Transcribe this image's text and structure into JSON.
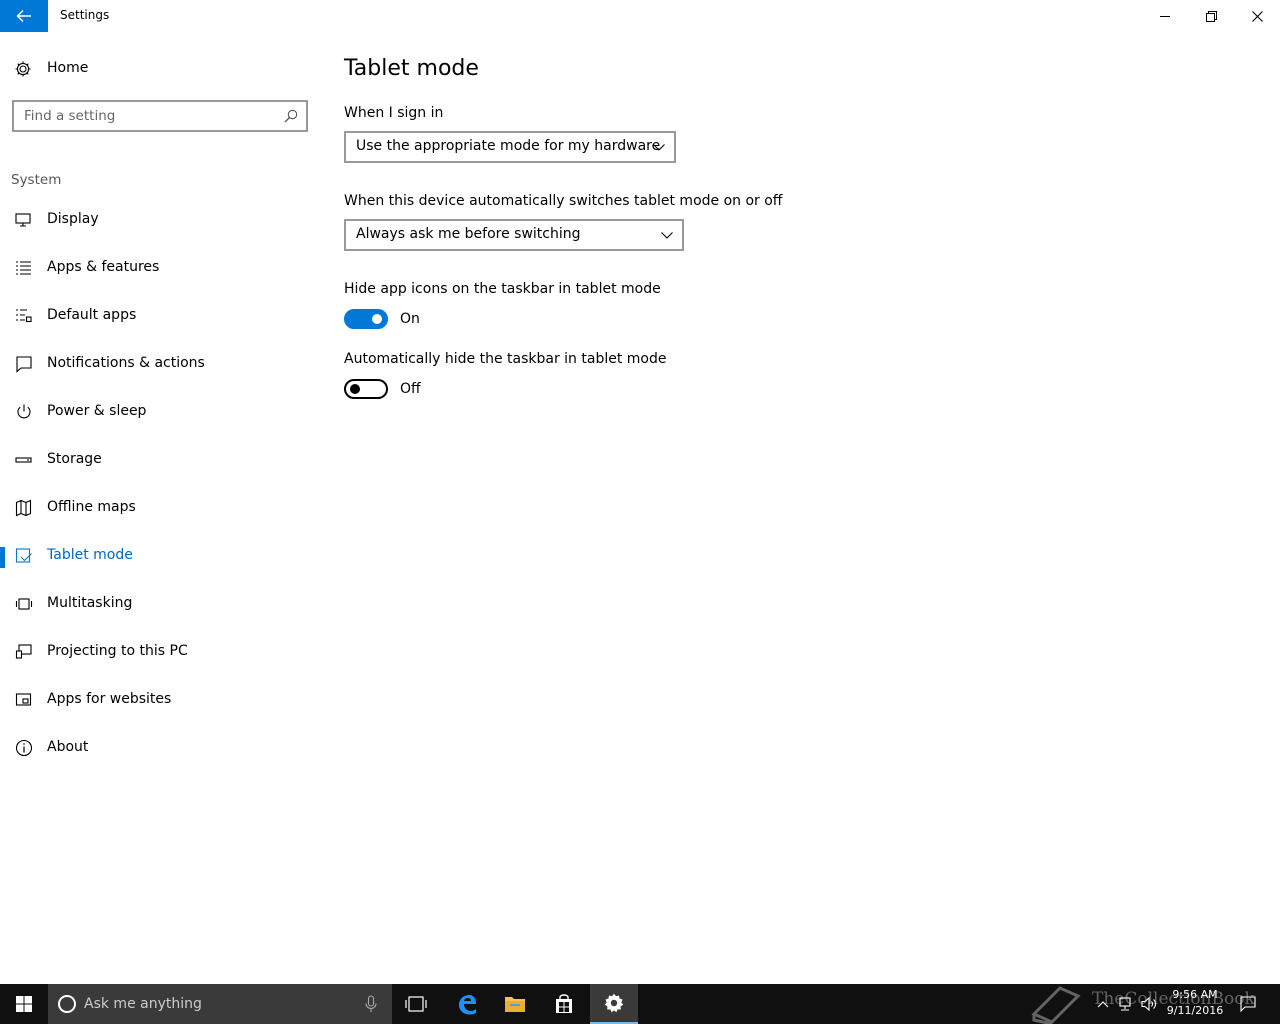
{
  "window": {
    "title": "Settings",
    "back_icon": "arrow-left-icon",
    "controls": [
      "minimize-icon",
      "restore-icon",
      "close-icon"
    ]
  },
  "sidebar": {
    "home_label": "Home",
    "search_placeholder": "Find a setting",
    "section_label": "System",
    "items": [
      {
        "label": "Display",
        "icon": "monitor-icon"
      },
      {
        "label": "Apps & features",
        "icon": "list-icon"
      },
      {
        "label": "Default apps",
        "icon": "default-apps-icon"
      },
      {
        "label": "Notifications & actions",
        "icon": "notification-icon"
      },
      {
        "label": "Power & sleep",
        "icon": "power-icon"
      },
      {
        "label": "Storage",
        "icon": "storage-icon"
      },
      {
        "label": "Offline maps",
        "icon": "map-icon"
      },
      {
        "label": "Tablet mode",
        "icon": "tablet-icon",
        "active": true
      },
      {
        "label": "Multitasking",
        "icon": "multitasking-icon"
      },
      {
        "label": "Projecting to this PC",
        "icon": "projecting-icon"
      },
      {
        "label": "Apps for websites",
        "icon": "apps-websites-icon"
      },
      {
        "label": "About",
        "icon": "info-icon"
      }
    ]
  },
  "main": {
    "title": "Tablet mode",
    "sign_in": {
      "label": "When I sign in",
      "value": "Use the appropriate mode for my hardware"
    },
    "auto_switch": {
      "label": "When this device automatically switches tablet mode on or off",
      "value": "Always ask me before switching"
    },
    "hide_icons": {
      "label": "Hide app icons on the taskbar in tablet mode",
      "state": "On",
      "on": true
    },
    "hide_taskbar": {
      "label": "Automatically hide the taskbar in tablet mode",
      "state": "Off",
      "on": false
    }
  },
  "taskbar": {
    "search_text": "Ask me anything",
    "apps": [
      "task-view-icon",
      "edge-icon",
      "file-explorer-icon",
      "store-icon",
      "settings-icon"
    ],
    "active_app": "settings-icon",
    "time": "9:56 AM",
    "date": "9/11/2016",
    "watermark": "TheCollectionBook"
  },
  "colors": {
    "accent": "#0078d7",
    "active_text": "#0067c0",
    "taskbar_bg": "#101010"
  }
}
